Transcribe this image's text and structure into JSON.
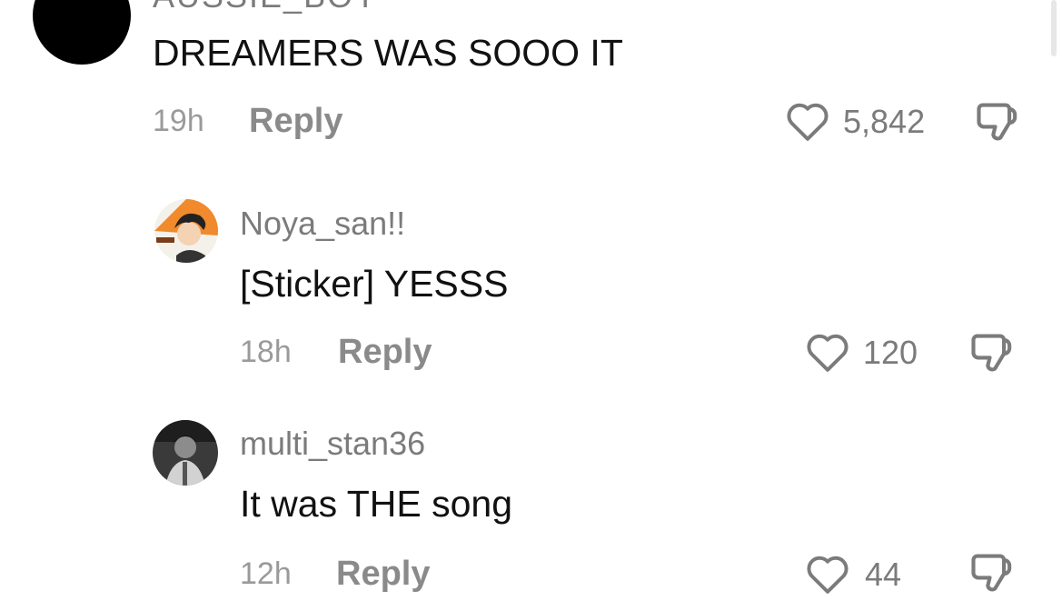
{
  "comments": [
    {
      "username": "AUSSIE_BOY",
      "text": "DREAMERS WAS SOOO IT",
      "time": "19h",
      "reply_label": "Reply",
      "likes": "5,842"
    },
    {
      "username": "Noya_san!!",
      "text": "[Sticker] YESSS",
      "time": "18h",
      "reply_label": "Reply",
      "likes": "120"
    },
    {
      "username": "multi_stan36",
      "text": "It was THE song",
      "time": "12h",
      "reply_label": "Reply",
      "likes": "44"
    }
  ],
  "icons": {
    "like": "heart-outline-icon",
    "dislike": "thumbs-down-outline-icon"
  },
  "colors": {
    "text": "#111111",
    "muted": "#7b7b7b",
    "time": "#9a9a9a",
    "avatar_orange": "#f08a2c"
  }
}
